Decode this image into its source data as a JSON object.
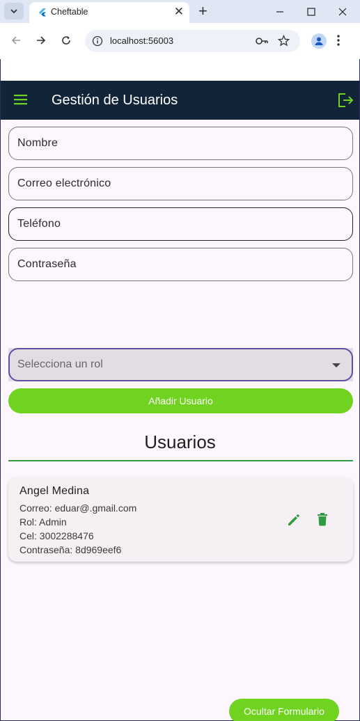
{
  "browser": {
    "tab_title": "Cheftable",
    "url": "localhost:56003",
    "new_tab_symbol": "+",
    "close_tab_symbol": "✕"
  },
  "appbar": {
    "title": "Gestión de Usuarios",
    "color": "#122538",
    "accent": "#6fd31f"
  },
  "form": {
    "name_placeholder": "Nombre",
    "email_placeholder": "Correo electrónico",
    "phone_placeholder": "Teléfono",
    "password_placeholder": "Contraseña",
    "role_placeholder": "Selecciona un rol",
    "add_button": "Añadir Usuario"
  },
  "users_section": {
    "title": "Usuarios",
    "users": [
      {
        "name": "Angel Medina",
        "email": "Correo: eduar@.gmail.com",
        "role": "Rol: Admin",
        "phone": "Cel: 3002288476",
        "password": "Contraseña: 8d969eef6"
      }
    ]
  },
  "footer": {
    "toggle_button": "Ocultar Formulario"
  },
  "icons": [
    "menu-icon",
    "logout-icon",
    "edit-icon",
    "delete-icon"
  ]
}
